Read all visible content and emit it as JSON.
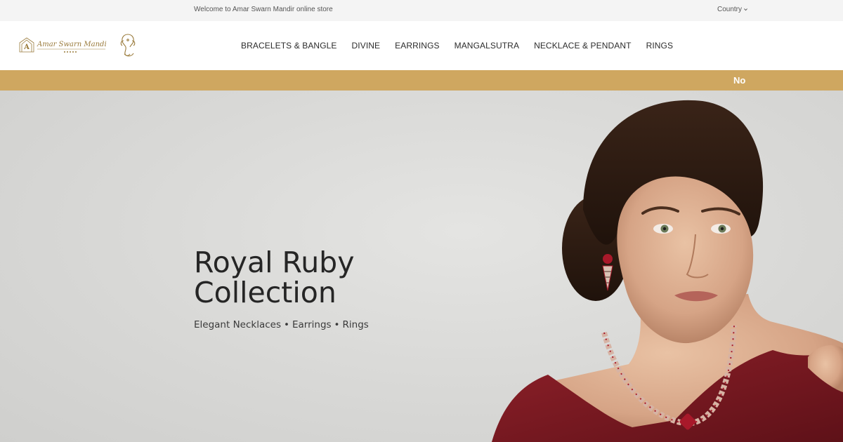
{
  "topbar": {
    "welcome": "Welcome to Amar Swarn Mandir online store",
    "country_label": "Country"
  },
  "header": {
    "logo_text": "Amar Swarn Mandir",
    "nav": [
      {
        "label": "BRACELETS & BANGLE"
      },
      {
        "label": "DIVINE"
      },
      {
        "label": "EARRINGS"
      },
      {
        "label": "MANGALSUTRA"
      },
      {
        "label": "NECKLACE & PENDANT"
      },
      {
        "label": "RINGS"
      }
    ]
  },
  "announcement": {
    "text": "No"
  },
  "hero": {
    "title_line1": "Royal Ruby",
    "title_line2": "Collection",
    "subtitle_items": [
      "Elegant Necklaces",
      "Earrings",
      "Rings"
    ],
    "separator": "•"
  },
  "colors": {
    "gold_strip": "#cfa760",
    "gold_logo": "#9a7b3c",
    "dress": "#7a1a22",
    "ruby": "#a8192a"
  },
  "icons": {
    "country_dropdown": "chevron-down-icon"
  }
}
